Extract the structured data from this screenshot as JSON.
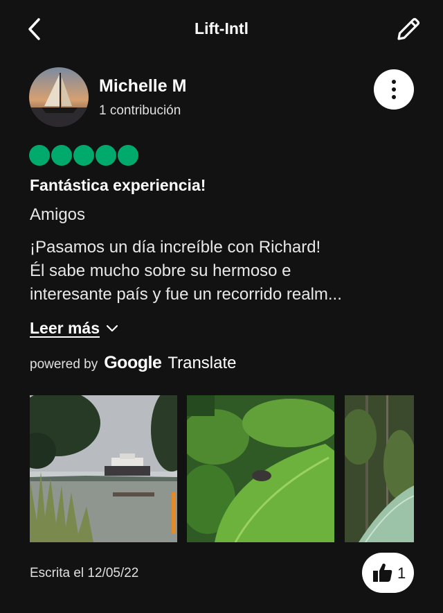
{
  "header": {
    "title": "Lift-Intl",
    "back_icon": "chevron-left-icon",
    "edit_icon": "pencil-icon"
  },
  "author": {
    "name": "Michelle M",
    "contributions": "1 contribución",
    "avatar": "sailboat-photo",
    "more_icon": "more-vertical-icon"
  },
  "review": {
    "rating": 5,
    "rating_color": "#00aa6c",
    "title": "Fantástica experiencia!",
    "trip_type": "Amigos",
    "text_lines": [
      "¡Pasamos un día increíble con Richard!",
      "Él sabe mucho sobre su hermoso e",
      "interesante país y fue un recorrido realm..."
    ],
    "read_more": "Leer más",
    "powered_by": "powered by",
    "google": "Google",
    "translate": "Translate"
  },
  "photos": [
    {
      "name": "ship-on-lake-photo"
    },
    {
      "name": "butterfly-on-leaf-photo"
    },
    {
      "name": "forest-photo"
    }
  ],
  "footer": {
    "written": "Escrita el 12/05/22",
    "helpful_count": "1",
    "helpful_icon": "thumbs-up-icon"
  }
}
